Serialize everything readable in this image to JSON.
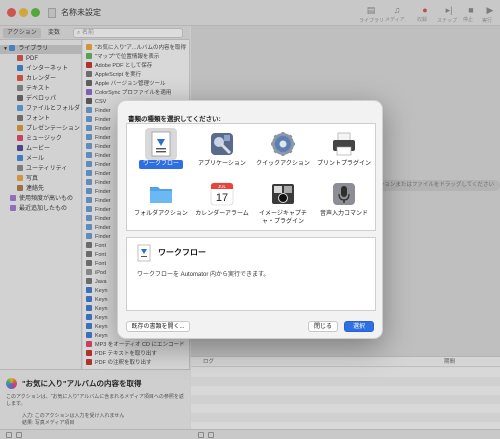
{
  "window": {
    "title": "名称未設定"
  },
  "toolbar": {
    "buttons": [
      {
        "label": "ライブラリ",
        "icon": "library-icon"
      },
      {
        "label": "メディア",
        "icon": "media-icon"
      },
      {
        "label": "収録",
        "icon": "record-icon"
      },
      {
        "label": "ステップ",
        "icon": "step-icon"
      },
      {
        "label": "停止",
        "icon": "stop-icon"
      },
      {
        "label": "実行",
        "icon": "run-icon"
      }
    ]
  },
  "library_bar": {
    "tab_actions": "アクション",
    "tab_variables": "変数",
    "search_placeholder": "名前"
  },
  "library": {
    "items": [
      {
        "label": "ライブラリ",
        "color": "#4a90e2",
        "selected": true
      },
      {
        "label": "PDF",
        "color": "#d9534f"
      },
      {
        "label": "インターネット",
        "color": "#3a86d8"
      },
      {
        "label": "カレンダー",
        "color": "#e5553f"
      },
      {
        "label": "テキスト",
        "color": "#888888"
      },
      {
        "label": "デベロッパ",
        "color": "#666666"
      },
      {
        "label": "ファイルとフォルダ",
        "color": "#5aa0e8"
      },
      {
        "label": "フォント",
        "color": "#777777"
      },
      {
        "label": "プレゼンテーション",
        "color": "#e39a33"
      },
      {
        "label": "ミュージック",
        "color": "#e8436a"
      },
      {
        "label": "ムービー",
        "color": "#4a4a9a"
      },
      {
        "label": "メール",
        "color": "#3b8de0"
      },
      {
        "label": "ユーティリティ",
        "color": "#8a8a8a"
      },
      {
        "label": "写真",
        "color": "#f2a93b"
      },
      {
        "label": "連絡先",
        "color": "#b07a4a"
      },
      {
        "label": "使用頻度が高いもの",
        "color": "#a27ad6"
      },
      {
        "label": "最近追加したもの",
        "color": "#a27ad6"
      }
    ]
  },
  "actions": {
    "items": [
      "\"お気に入り\"ア...ルバムの内容を取得",
      "\"マップ\"で位置情報を表示",
      "Adobe PDF として保存",
      "AppleScript を実行",
      "Apple バージョン管理ツール",
      "ColorSync プロファイルを適用",
      "CSV",
      "Finder",
      "Finder",
      "Finder",
      "Finder",
      "Finder",
      "Finder",
      "Finder",
      "Finder",
      "Finder",
      "Finder",
      "Finder",
      "Finder",
      "Finder",
      "Finder",
      "Finder",
      "Font",
      "Font",
      "Font",
      "iPod",
      "Java",
      "Keyn",
      "Keyn",
      "Keyn",
      "Keyn",
      "Keyn",
      "Keyn",
      "MP3 をオーディオ CD にエンコード",
      "PDF テキストを取り出す",
      "PDF の注釈を取り出す",
      "PDF ページを並べ替える"
    ]
  },
  "workflow": {
    "drag_hint": "ここにアクションまたはファイルをドラッグしてください"
  },
  "log": {
    "col_log": "ログ",
    "col_duration": "期間"
  },
  "description": {
    "title": "\"お気に入り\"アルバムの内容を取得",
    "text": "このアクションは、\"お気に入り\"アルバムに含まれるメディア項目への参照を返します。",
    "input": "入力: このアクションは入力を受け入れません",
    "result": "結果: 写真メディア項目"
  },
  "dialog": {
    "prompt": "書類の種類を選択してください:",
    "types": [
      {
        "label": "ワークフロー",
        "icon": "workflow-icon",
        "selected": true
      },
      {
        "label": "アプリケーション",
        "icon": "application-icon"
      },
      {
        "label": "クイックアクション",
        "icon": "quick-action-gear-icon"
      },
      {
        "label": "プリントプラグイン",
        "icon": "printer-icon"
      },
      {
        "label": "フォルダアクション",
        "icon": "folder-icon"
      },
      {
        "label": "カレンダーアラーム",
        "icon": "calendar-icon",
        "month": "JUL",
        "day": "17"
      },
      {
        "label1": "イメージキャプチ",
        "label2": "ャ・プラグイン",
        "icon": "image-capture-icon"
      },
      {
        "label": "音声入力コマンド",
        "icon": "microphone-icon"
      }
    ],
    "info_title": "ワークフロー",
    "info_desc": "ワークフローを Automator 内から実行できます。",
    "open_existing": "既存の書類を開く...",
    "close": "閉じる",
    "select": "選択"
  }
}
